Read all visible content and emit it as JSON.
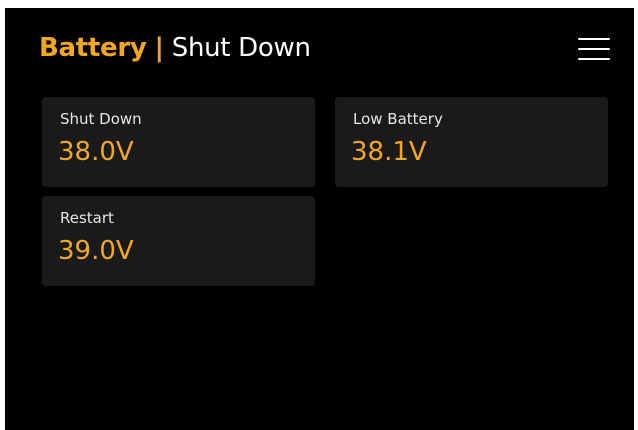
{
  "header": {
    "app_title": "Battery",
    "separator": "|",
    "page_title": "Shut Down",
    "menu_icon": "hamburger-menu-icon"
  },
  "colors": {
    "accent": "#F5A623",
    "background": "#000000",
    "card_background": "#1a1a1a",
    "text": "#ffffff"
  },
  "cards": [
    {
      "label": "Shut Down",
      "value": "38.0V"
    },
    {
      "label": "Low Battery",
      "value": "38.1V"
    },
    {
      "label": "Restart",
      "value": "39.0V"
    }
  ]
}
